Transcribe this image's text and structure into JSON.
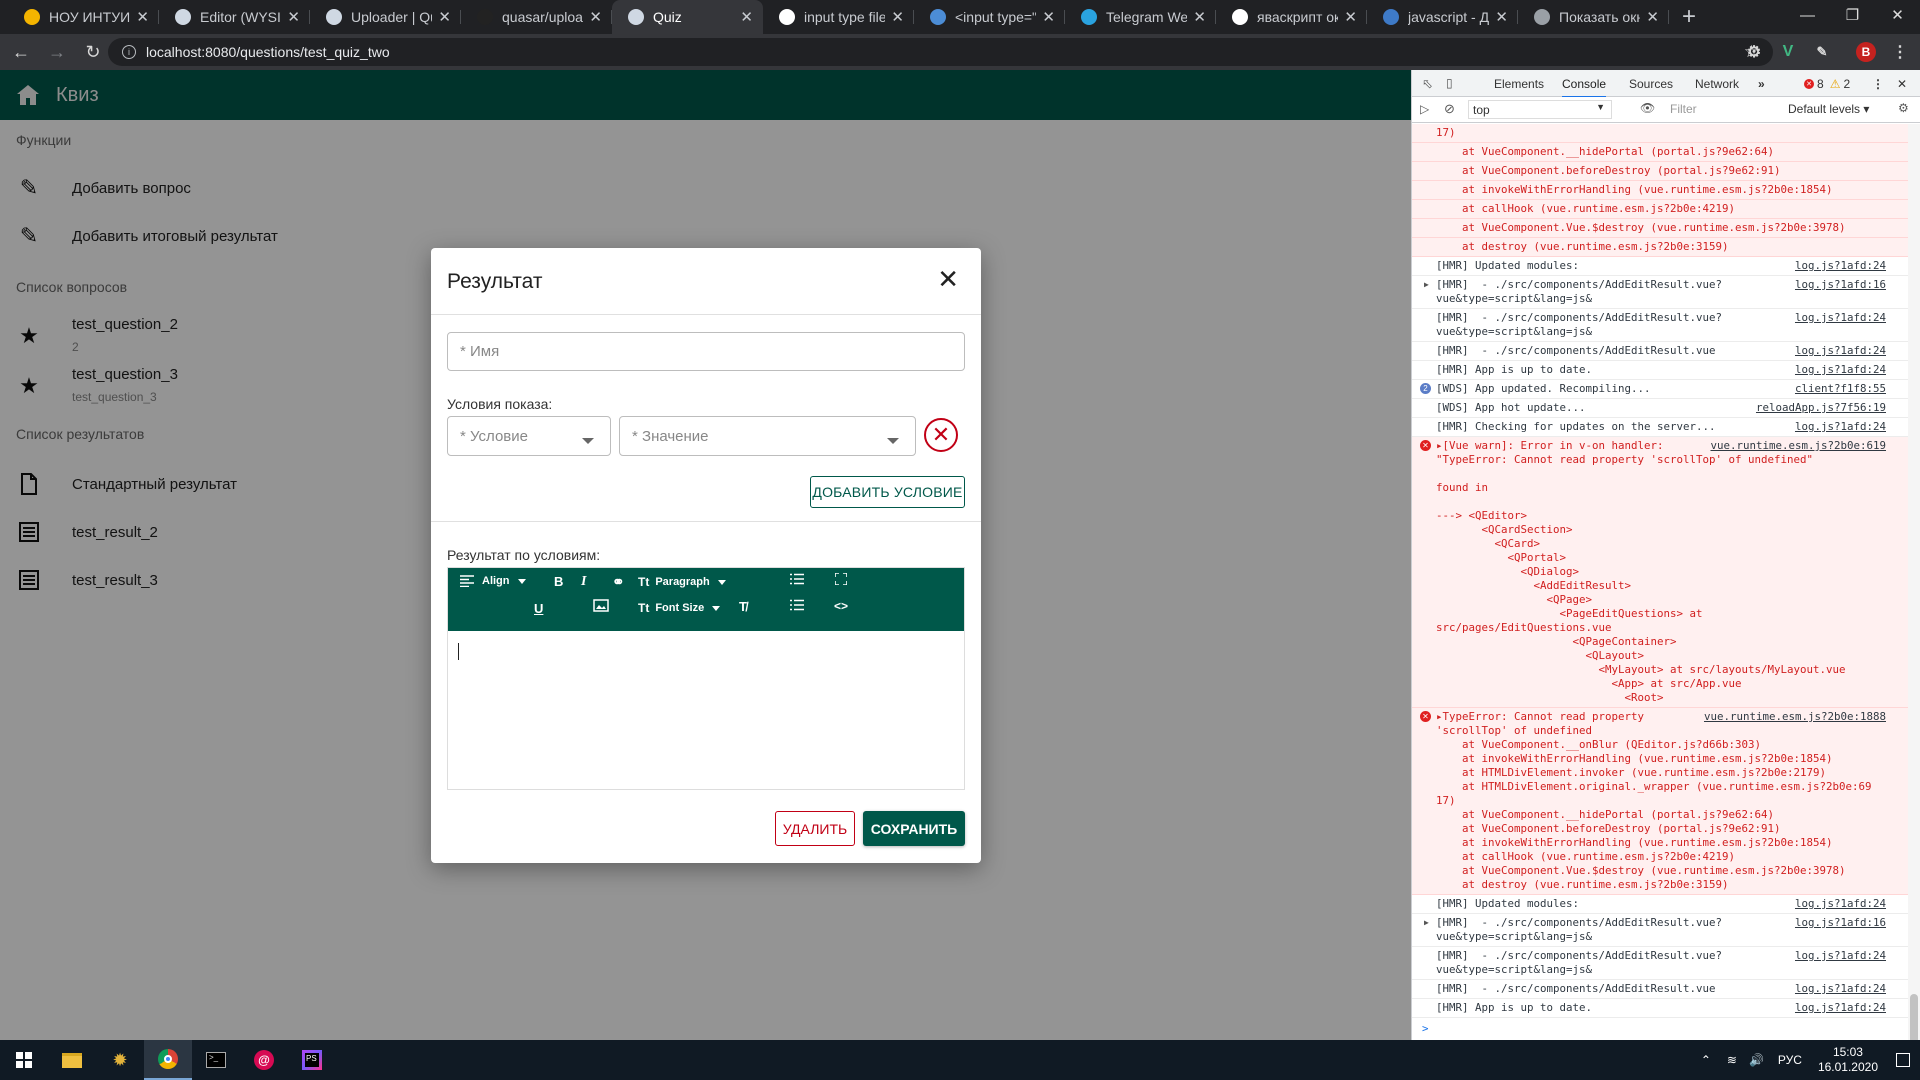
{
  "browser": {
    "tabs": [
      {
        "title": "НОУ ИНТУИТ | Л",
        "favicon": "intuit-icon",
        "color": "#f4b400",
        "active": false
      },
      {
        "title": "Editor (WYSIWYG",
        "favicon": "quasar-icon",
        "color": "#cfd8e3",
        "active": false
      },
      {
        "title": "Uploader | Quasa",
        "favicon": "quasar-icon",
        "color": "#cfd8e3",
        "active": false
      },
      {
        "title": "quasar/uploader",
        "favicon": "github-icon",
        "color": "#222222",
        "active": false
      },
      {
        "title": "Quiz",
        "favicon": "quasar-icon",
        "color": "#cfd8e3",
        "active": true
      },
      {
        "title": "input type file - f",
        "favicon": "google-icon",
        "color": "#ffffff",
        "active": false
      },
      {
        "title": "<input type=\"file",
        "favicon": "htmlbook-icon",
        "color": "#4c8dd6",
        "active": false
      },
      {
        "title": "Telegram Web",
        "favicon": "telegram-icon",
        "color": "#2aa3e0",
        "active": false
      },
      {
        "title": "яваскрипт окно",
        "favicon": "google-icon",
        "color": "#ffffff",
        "active": false
      },
      {
        "title": "javascript - Диал",
        "favicon": "stackoverflow-icon",
        "color": "#3e7ac7",
        "active": false
      },
      {
        "title": "Показать окно в",
        "favicon": "page-icon",
        "color": "#9aa0a6",
        "active": false
      }
    ],
    "url": "localhost:8080/questions/test_quiz_two",
    "profile_initial": "B"
  },
  "app": {
    "title": "Квиз",
    "drawer": {
      "functions_header": "Функции",
      "functions": [
        {
          "label": "Добавить вопрос",
          "icon": "pencil-icon"
        },
        {
          "label": "Добавить итоговый результат",
          "icon": "pencil-icon"
        }
      ],
      "questions_header": "Список вопросов",
      "questions": [
        {
          "label": "test_question_2",
          "caption": "2",
          "icon": "star-icon"
        },
        {
          "label": "test_question_3",
          "caption": "test_question_3",
          "icon": "star-icon"
        }
      ],
      "results_header": "Список результатов",
      "results": [
        {
          "label": "Стандартный результат",
          "icon": "document-icon"
        },
        {
          "label": "test_result_2",
          "icon": "list-icon"
        },
        {
          "label": "test_result_3",
          "icon": "list-icon"
        }
      ]
    }
  },
  "dialog": {
    "title": "Результат",
    "name_placeholder": "* Имя",
    "conditions_label": "Условия показа:",
    "condition_placeholder": "* Условие",
    "value_placeholder": "* Значение",
    "add_condition": "ДОБАВИТЬ УСЛОВИЕ",
    "result_label": "Результат по условиям:",
    "toolbar": {
      "align": "Align",
      "paragraph": "Paragraph",
      "font_size": "Font Size"
    },
    "delete": "УДАЛИТЬ",
    "save": "СОХРАНИТЬ"
  },
  "devtools": {
    "tabs": [
      "Elements",
      "Console",
      "Sources",
      "Network"
    ],
    "active_tab": "Console",
    "error_count": "8",
    "warning_count": "2",
    "context": "top",
    "filter_placeholder": "Filter",
    "levels": "Default levels",
    "rows": [
      {
        "type": "err-cont",
        "text": "17)"
      },
      {
        "type": "err-cont",
        "text": "    at VueComponent.__hidePortal (portal.js?9e62:64)"
      },
      {
        "type": "err-cont",
        "text": "    at VueComponent.beforeDestroy (portal.js?9e62:91)"
      },
      {
        "type": "err-cont",
        "text": "    at invokeWithErrorHandling (vue.runtime.esm.js?2b0e:1854)"
      },
      {
        "type": "err-cont",
        "text": "    at callHook (vue.runtime.esm.js?2b0e:4219)"
      },
      {
        "type": "err-cont",
        "text": "    at VueComponent.Vue.$destroy (vue.runtime.esm.js?2b0e:3978)"
      },
      {
        "type": "err-cont",
        "text": "    at destroy (vue.runtime.esm.js?2b0e:3159)"
      },
      {
        "type": "log",
        "text": "[HMR] Updated modules:",
        "src": "log.js?1afd:24"
      },
      {
        "type": "log-tri",
        "text": "[HMR]  - ./src/components/AddEditResult.vue?\nvue&type=script&lang=js&",
        "src": "log.js?1afd:16"
      },
      {
        "type": "log",
        "text": "[HMR]  - ./src/components/AddEditResult.vue?\nvue&type=script&lang=js&",
        "src": "log.js?1afd:24"
      },
      {
        "type": "log",
        "text": "[HMR]  - ./src/components/AddEditResult.vue",
        "src": "log.js?1afd:24"
      },
      {
        "type": "log",
        "text": "[HMR] App is up to date.",
        "src": "log.js?1afd:24"
      },
      {
        "type": "info",
        "text": "[WDS] App updated. Recompiling...",
        "src": "client?f1f8:55"
      },
      {
        "type": "log",
        "text": "[WDS] App hot update...",
        "src": "reloadApp.js?7f56:19"
      },
      {
        "type": "log",
        "text": "[HMR] Checking for updates on the server...",
        "src": "log.js?1afd:24"
      },
      {
        "type": "err",
        "text": "▸[Vue warn]: Error in v-on handler:\n\"TypeError: Cannot read property 'scrollTop' of undefined\"\n\nfound in\n\n---> <QEditor>\n       <QCardSection>\n         <QCard>\n           <QPortal>\n             <QDialog>\n               <AddEditResult>\n                 <QPage>\n                   <PageEditQuestions> at\nsrc/pages/EditQuestions.vue\n                     <QPageContainer>\n                       <QLayout>\n                         <MyLayout> at src/layouts/MyLayout.vue\n                           <App> at src/App.vue\n                             <Root>",
        "src": "vue.runtime.esm.js?2b0e:619"
      },
      {
        "type": "err",
        "text": "▸TypeError: Cannot read property\n'scrollTop' of undefined\n    at VueComponent.__onBlur (QEditor.js?d66b:303)\n    at invokeWithErrorHandling (vue.runtime.esm.js?2b0e:1854)\n    at HTMLDivElement.invoker (vue.runtime.esm.js?2b0e:2179)\n    at HTMLDivElement.original._wrapper (vue.runtime.esm.js?2b0e:69\n17)\n    at VueComponent.__hidePortal (portal.js?9e62:64)\n    at VueComponent.beforeDestroy (portal.js?9e62:91)\n    at invokeWithErrorHandling (vue.runtime.esm.js?2b0e:1854)\n    at callHook (vue.runtime.esm.js?2b0e:4219)\n    at VueComponent.Vue.$destroy (vue.runtime.esm.js?2b0e:3978)\n    at destroy (vue.runtime.esm.js?2b0e:3159)",
        "src": "vue.runtime.esm.js?2b0e:1888"
      },
      {
        "type": "log",
        "text": "[HMR] Updated modules:",
        "src": "log.js?1afd:24"
      },
      {
        "type": "log-tri",
        "text": "[HMR]  - ./src/components/AddEditResult.vue?\nvue&type=script&lang=js&",
        "src": "log.js?1afd:16"
      },
      {
        "type": "log",
        "text": "[HMR]  - ./src/components/AddEditResult.vue?\nvue&type=script&lang=js&",
        "src": "log.js?1afd:24"
      },
      {
        "type": "log",
        "text": "[HMR]  - ./src/components/AddEditResult.vue",
        "src": "log.js?1afd:24"
      },
      {
        "type": "log",
        "text": "[HMR] App is up to date.",
        "src": "log.js?1afd:24"
      }
    ],
    "prompt": ">"
  },
  "taskbar": {
    "apps": [
      "windows-start-icon",
      "file-explorer-icon",
      "slack-icon",
      "chrome-icon",
      "terminal-icon",
      "debian-icon",
      "phpstorm-icon"
    ],
    "language": "РУС",
    "time": "15:03",
    "date": "16.01.2020"
  },
  "colors": {
    "primary": "#00584a",
    "negative": "#c10015",
    "devtools_error": "#d12020"
  }
}
